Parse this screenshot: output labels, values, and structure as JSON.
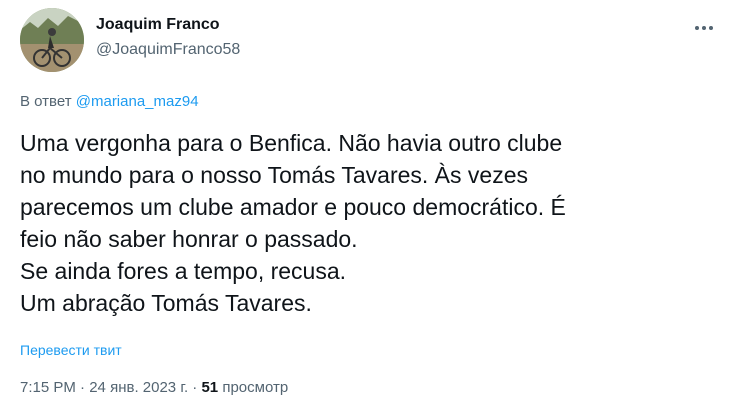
{
  "author": {
    "display_name": "Joaquim Franco",
    "handle": "@JoaquimFranco58",
    "avatar_icon": "avatar-cyclist-photo"
  },
  "more_icon": "more-horizontal-icon",
  "reply_context": {
    "prefix": "В ответ",
    "mention": "@mariana_maz94"
  },
  "tweet": {
    "lines": [
      "Uma vergonha para o Benfica. Não havia outro clube",
      "no mundo para o nosso Tomás Tavares. Às vezes",
      "parecemos um clube amador e pouco democrático. É",
      "feio não saber honrar o passado.",
      "Se ainda fores a tempo, recusa.",
      "Um abração Tomás Tavares."
    ]
  },
  "translate_label": "Перевести твит",
  "meta": {
    "time": "7:15 PM",
    "separator": "·",
    "date": "24 янв. 2023 г.",
    "views_count": "51",
    "views_label": "просмотр"
  },
  "colors": {
    "text": "#0f1419",
    "secondary": "#536471",
    "link": "#1d9bf0"
  }
}
